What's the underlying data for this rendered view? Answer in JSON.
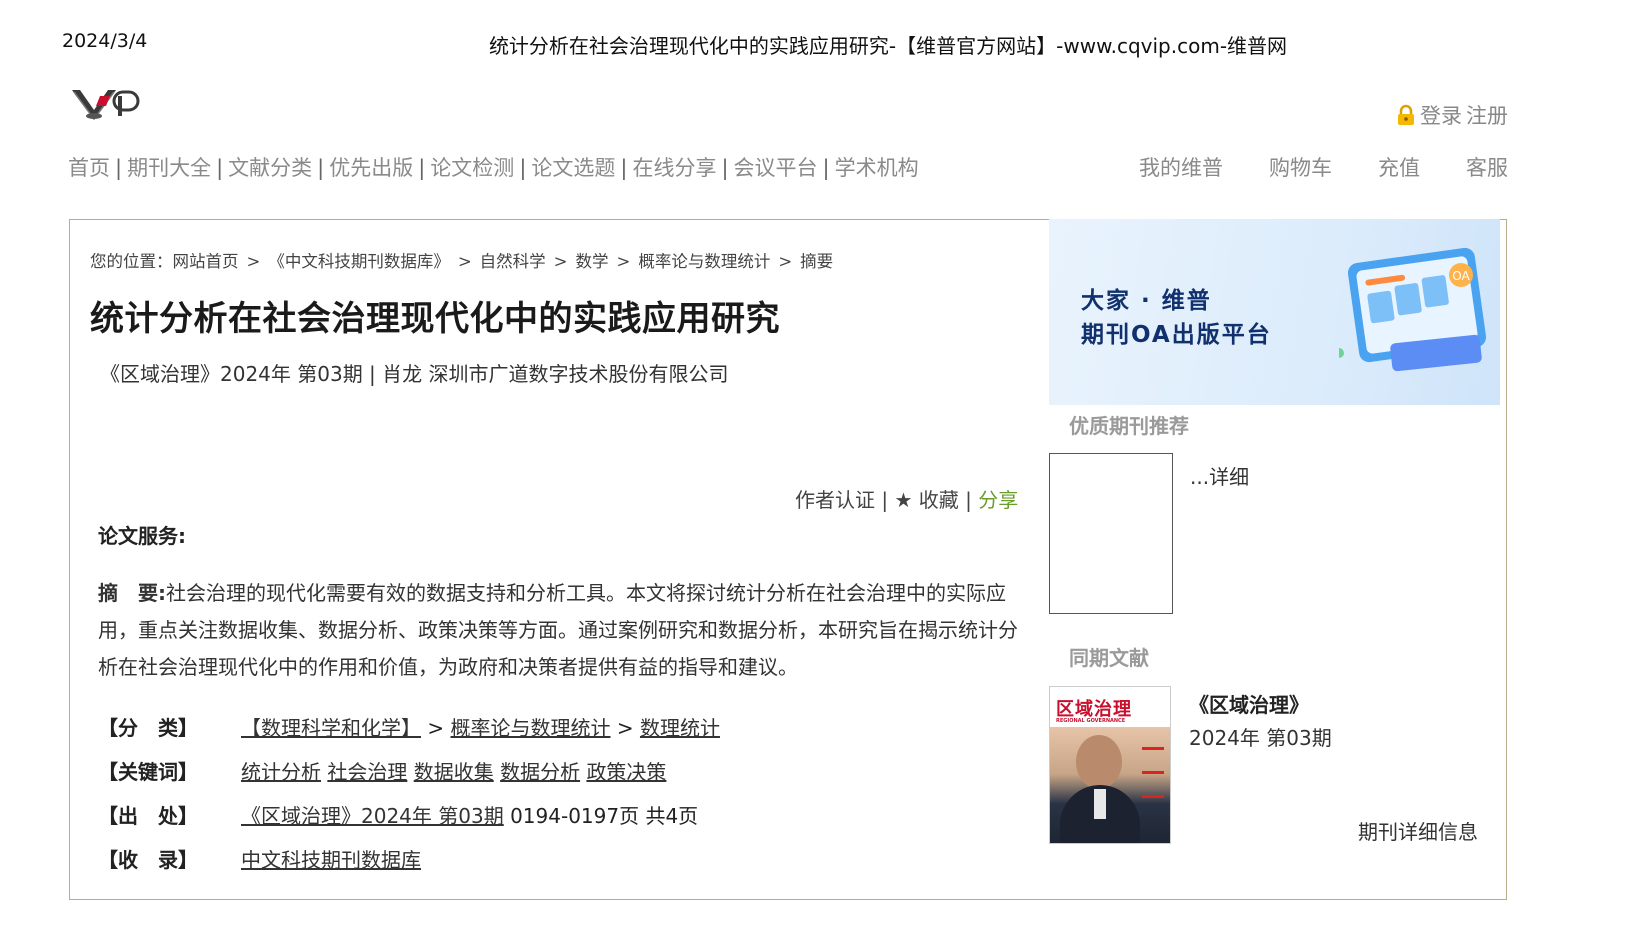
{
  "print_header": {
    "date": "2024/3/4",
    "page_title": "统计分析在社会治理现代化中的实践应用研究-【维普官方网站】-www.cqvip.com-维普网"
  },
  "header": {
    "logo_icon": "vip-logo",
    "lock_icon": "lock-icon",
    "login": "登录",
    "register": "注册",
    "nav": [
      "首页",
      "期刊大全",
      "文献分类",
      "优先出版",
      "论文检测",
      "论文选题",
      "在线分享",
      "会议平台",
      "学术机构"
    ],
    "nav_separator": "|",
    "user_nav": [
      "我的维普",
      "购物车",
      "充值",
      "客服"
    ]
  },
  "breadcrumb": {
    "prefix": "您的位置：",
    "items": [
      "网站首页",
      "《中文科技期刊数据库》",
      "自然科学",
      "数学",
      "概率论与数理统计",
      "摘要"
    ],
    "separator": ">"
  },
  "article": {
    "title": "统计分析在社会治理现代化中的实践应用研究",
    "meta": "《区域治理》2024年 第03期 | 肖龙   深圳市广道数字技术股份有限公司",
    "actions": {
      "author_cert": "作者认证",
      "favorite": "★ 收藏",
      "share": "分享",
      "sep": "|"
    },
    "service_label": "论文服务:",
    "abstract_label": "摘　要:",
    "abstract": "社会治理的现代化需要有效的数据支持和分析工具。本文将探讨统计分析在社会治理中的实际应用，重点关注数据收集、数据分析、政策决策等方面。通过案例研究和数据分析，本研究旨在揭示统计分析在社会治理现代化中的作用和价值，为政府和决策者提供有益的指导和建议。",
    "classification": {
      "label": "【分　类】",
      "items": [
        "【数理科学和化学】",
        "概率论与数理统计",
        "数理统计"
      ],
      "sep": ">"
    },
    "keywords": {
      "label": "【关键词】",
      "items": [
        "统计分析",
        "社会治理",
        "数据收集",
        "数据分析",
        "政策决策"
      ]
    },
    "source": {
      "label": "【出　处】",
      "link": "《区域治理》2024年 第03期",
      "pages": " 0194-0197页 共4页"
    },
    "indexed": {
      "label": "【收　录】",
      "link": "中文科技期刊数据库"
    }
  },
  "sidebar": {
    "banner_line1": "大家 · 维普",
    "banner_line2": "期刊OA出版平台",
    "banner_badge": "OA",
    "quality_title": "优质期刊推荐",
    "detail_link": "...详细",
    "same_issue_title": "同期文献",
    "cover_title": "区域治理",
    "cover_subtitle": "REGIONAL GOVERNANCE",
    "journal_name": "《区域治理》",
    "journal_issue": "2024年 第03期",
    "journal_info_link": "期刊详细信息"
  },
  "colors": {
    "frame_border": "#b9ab8e",
    "nav_text": "#8a8a8a",
    "share_green": "#6a9d2b",
    "banner_text": "#10306e",
    "cover_red": "#c8102e"
  }
}
